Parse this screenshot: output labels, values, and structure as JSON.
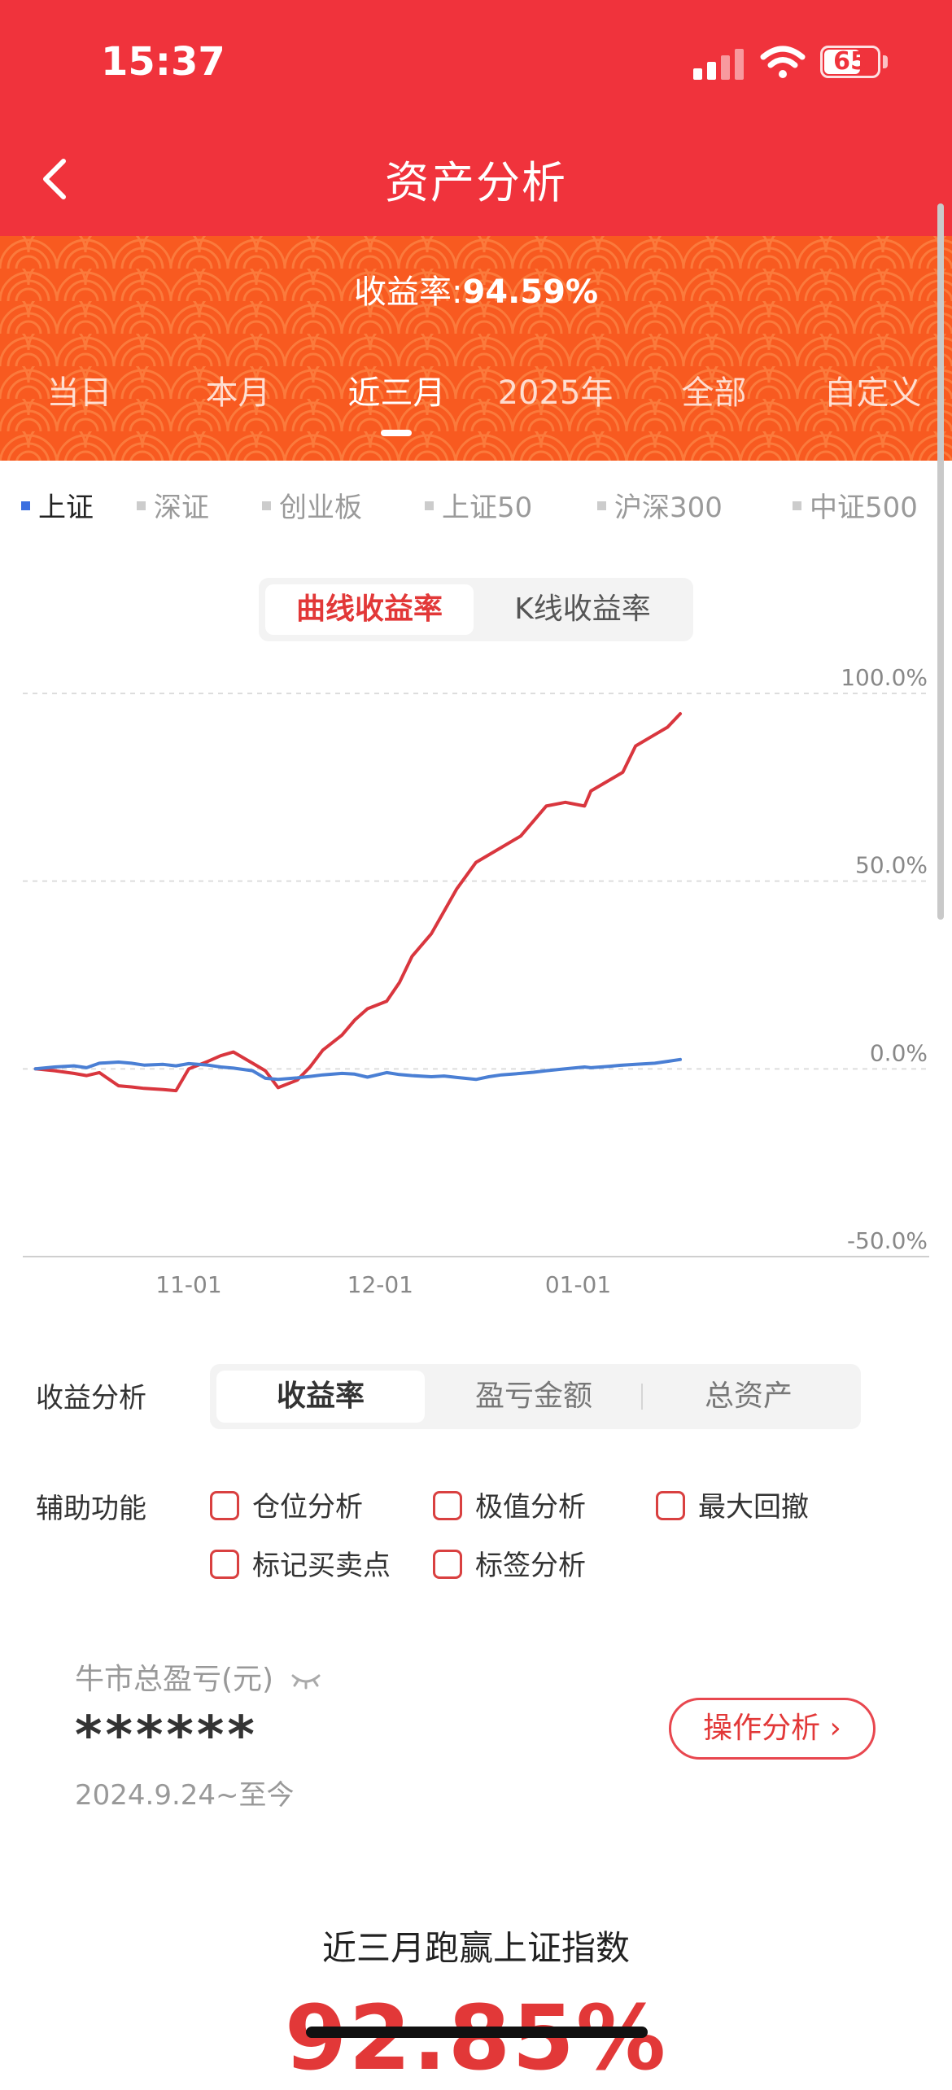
{
  "status": {
    "time": "15:37",
    "battery": "65"
  },
  "nav": {
    "title": "资产分析"
  },
  "banner": {
    "yield_label": "收益率:",
    "yield_value": "94.59%",
    "tabs": [
      "当日",
      "本月",
      "近三月",
      "2025年",
      "全部",
      "自定义"
    ],
    "active_tab": "近三月"
  },
  "indices": {
    "items": [
      "上证",
      "深证",
      "创业板",
      "上证50",
      "沪深300",
      "中证500"
    ],
    "active": "上证"
  },
  "chart_toggle": {
    "options": [
      "曲线收益率",
      "K线收益率"
    ],
    "active": "曲线收益率"
  },
  "chart_data": {
    "type": "line",
    "y_tick_labels": [
      "100.0%",
      "50.0%",
      "0.0%",
      "-50.0%"
    ],
    "x_tick_labels": [
      "11-01",
      "12-01",
      "01-01"
    ],
    "ylim": [
      -50,
      100
    ],
    "grid": true,
    "series": [
      {
        "color": "#d9363e",
        "x": [
          "2024-10-08",
          "2024-10-11",
          "2024-10-14",
          "2024-10-16",
          "2024-10-18",
          "2024-10-21",
          "2024-10-23",
          "2024-10-25",
          "2024-10-28",
          "2024-10-30",
          "2024-11-01",
          "2024-11-04",
          "2024-11-06",
          "2024-11-08",
          "2024-11-11",
          "2024-11-13",
          "2024-11-15",
          "2024-11-18",
          "2024-11-20",
          "2024-11-22",
          "2024-11-25",
          "2024-11-27",
          "2024-11-29",
          "2024-12-02",
          "2024-12-04",
          "2024-12-06",
          "2024-12-09",
          "2024-12-11",
          "2024-12-13",
          "2024-12-16",
          "2024-12-18",
          "2024-12-20",
          "2024-12-23",
          "2024-12-25",
          "2024-12-27",
          "2024-12-30",
          "2025-01-02",
          "2025-01-03",
          "2025-01-06",
          "2025-01-08",
          "2025-01-10",
          "2025-01-13",
          "2025-01-15",
          "2025-01-17"
        ],
        "values": [
          0.0,
          -0.5,
          -1.2,
          -1.8,
          -1.0,
          -4.5,
          -4.8,
          -5.2,
          -5.5,
          -5.8,
          0,
          2.0,
          3.5,
          4.5,
          1.5,
          -0.5,
          -5.0,
          -3.0,
          0.5,
          5.0,
          9.0,
          13.0,
          16.0,
          18.0,
          23.0,
          30.0,
          36.0,
          42.0,
          48.0,
          55.0,
          57.0,
          59.0,
          62.0,
          66.0,
          70.0,
          71.0,
          70.0,
          74.0,
          77.0,
          79.0,
          86.0,
          89.0,
          91.0,
          94.59
        ]
      },
      {
        "color": "#4a7fd4",
        "x": [
          "2024-10-08",
          "2024-10-11",
          "2024-10-14",
          "2024-10-16",
          "2024-10-18",
          "2024-10-21",
          "2024-10-23",
          "2024-10-25",
          "2024-10-28",
          "2024-10-30",
          "2024-11-01",
          "2024-11-04",
          "2024-11-06",
          "2024-11-08",
          "2024-11-11",
          "2024-11-13",
          "2024-11-15",
          "2024-11-18",
          "2024-11-20",
          "2024-11-22",
          "2024-11-25",
          "2024-11-27",
          "2024-11-29",
          "2024-12-02",
          "2024-12-04",
          "2024-12-06",
          "2024-12-09",
          "2024-12-11",
          "2024-12-13",
          "2024-12-16",
          "2024-12-18",
          "2024-12-20",
          "2024-12-23",
          "2024-12-25",
          "2024-12-27",
          "2024-12-30",
          "2025-01-02",
          "2025-01-03",
          "2025-01-06",
          "2025-01-08",
          "2025-01-10",
          "2025-01-13",
          "2025-01-15",
          "2025-01-17"
        ],
        "values": [
          0.0,
          0.5,
          0.8,
          0.3,
          1.5,
          1.8,
          1.5,
          1.0,
          1.2,
          0.8,
          1.4,
          1.0,
          0.5,
          0.2,
          -0.5,
          -2.5,
          -2.8,
          -2.4,
          -2.0,
          -1.6,
          -1.2,
          -1.4,
          -2.2,
          -1.0,
          -1.5,
          -1.8,
          -2.1,
          -1.9,
          -2.3,
          -2.8,
          -2.1,
          -1.6,
          -1.2,
          -0.9,
          -0.5,
          0.0,
          0.5,
          0.3,
          0.7,
          1.0,
          1.2,
          1.5,
          2.0,
          2.5
        ]
      }
    ]
  },
  "analysis": {
    "label": "收益分析",
    "options": [
      "收益率",
      "盈亏金额",
      "总资产"
    ],
    "active": "收益率"
  },
  "assist": {
    "label": "辅助功能",
    "options": [
      "仓位分析",
      "极值分析",
      "最大回撤",
      "标记买卖点",
      "标签分析"
    ]
  },
  "pnl": {
    "label": "牛市总盈亏(元)",
    "value": "******",
    "date_range": "2024.9.24~至今",
    "button": "操作分析 ›"
  },
  "beat": {
    "label": "近三月跑赢上证指数",
    "value": "92.85%"
  }
}
